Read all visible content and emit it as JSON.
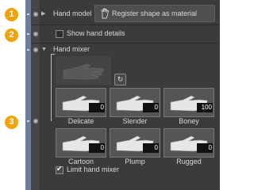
{
  "callouts": [
    "1",
    "2",
    "3"
  ],
  "rows": {
    "hand_model": {
      "label": "Hand model",
      "button_label": "Register shape as material"
    },
    "show_hand_details": {
      "label": "Show hand details",
      "checked": false
    },
    "hand_mixer": {
      "label": "Hand mixer"
    }
  },
  "presets": [
    {
      "name": "Delicate",
      "value": "0"
    },
    {
      "name": "Slender",
      "value": "0"
    },
    {
      "name": "Boney",
      "value": "100"
    },
    {
      "name": "Cartoon",
      "value": "0"
    },
    {
      "name": "Plump",
      "value": "0"
    },
    {
      "name": "Rugged",
      "value": "0"
    }
  ],
  "limit_hand_mixer": {
    "label": "Limit hand mixer",
    "checked": true
  },
  "icons": {
    "eye": "eye-icon",
    "expand": "expand-arrow-icon",
    "reset": "reset-icon",
    "register": "hand-register-icon"
  },
  "colors": {
    "panel": "#3b3b3b",
    "strip": "#6d7c9a",
    "callout": "#f2a20a"
  }
}
